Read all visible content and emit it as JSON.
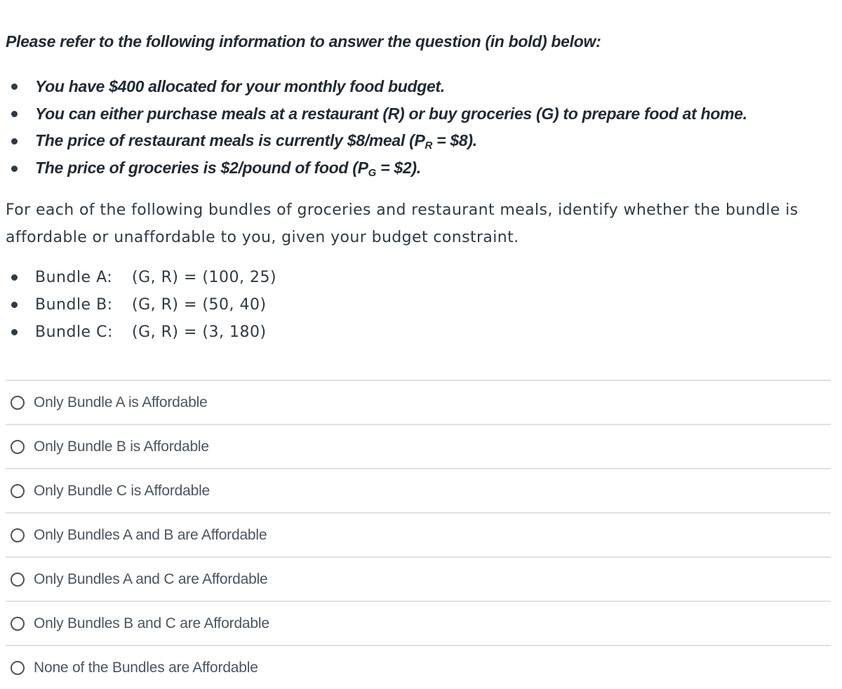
{
  "intro": "Please refer to the following information to answer the question (in bold) below:",
  "info": [
    {
      "text": "You have $400 allocated for your monthly food budget."
    },
    {
      "text": "You can either purchase meals at a restaurant (R) or buy groceries (G) to prepare food at home."
    },
    {
      "pre": "The price of restaurant meals is currently $8/meal (P",
      "sub": "R",
      "post": " = $8)."
    },
    {
      "pre": "The price of groceries is $2/pound of food (P",
      "sub": "G",
      "post": " = $2)."
    }
  ],
  "question": "For each of the following bundles of groceries and restaurant meals, identify whether the bundle is affordable or unaffordable to you, given your budget constraint.",
  "bundles": [
    {
      "label": "Bundle A:",
      "value": "(G, R) = (100, 25)"
    },
    {
      "label": "Bundle B:",
      "value": "(G, R) = (50, 40)"
    },
    {
      "label": "Bundle C:",
      "value": "(G, R) = (3, 180)"
    }
  ],
  "options": [
    {
      "label": "Only Bundle A is Affordable"
    },
    {
      "label": "Only Bundle B is Affordable"
    },
    {
      "label": "Only Bundle C is Affordable"
    },
    {
      "label": "Only Bundles A and B are Affordable"
    },
    {
      "label": "Only Bundles A and C are Affordable"
    },
    {
      "label": "Only Bundles B and C are Affordable"
    },
    {
      "label": "None of the Bundles are Affordable"
    }
  ]
}
